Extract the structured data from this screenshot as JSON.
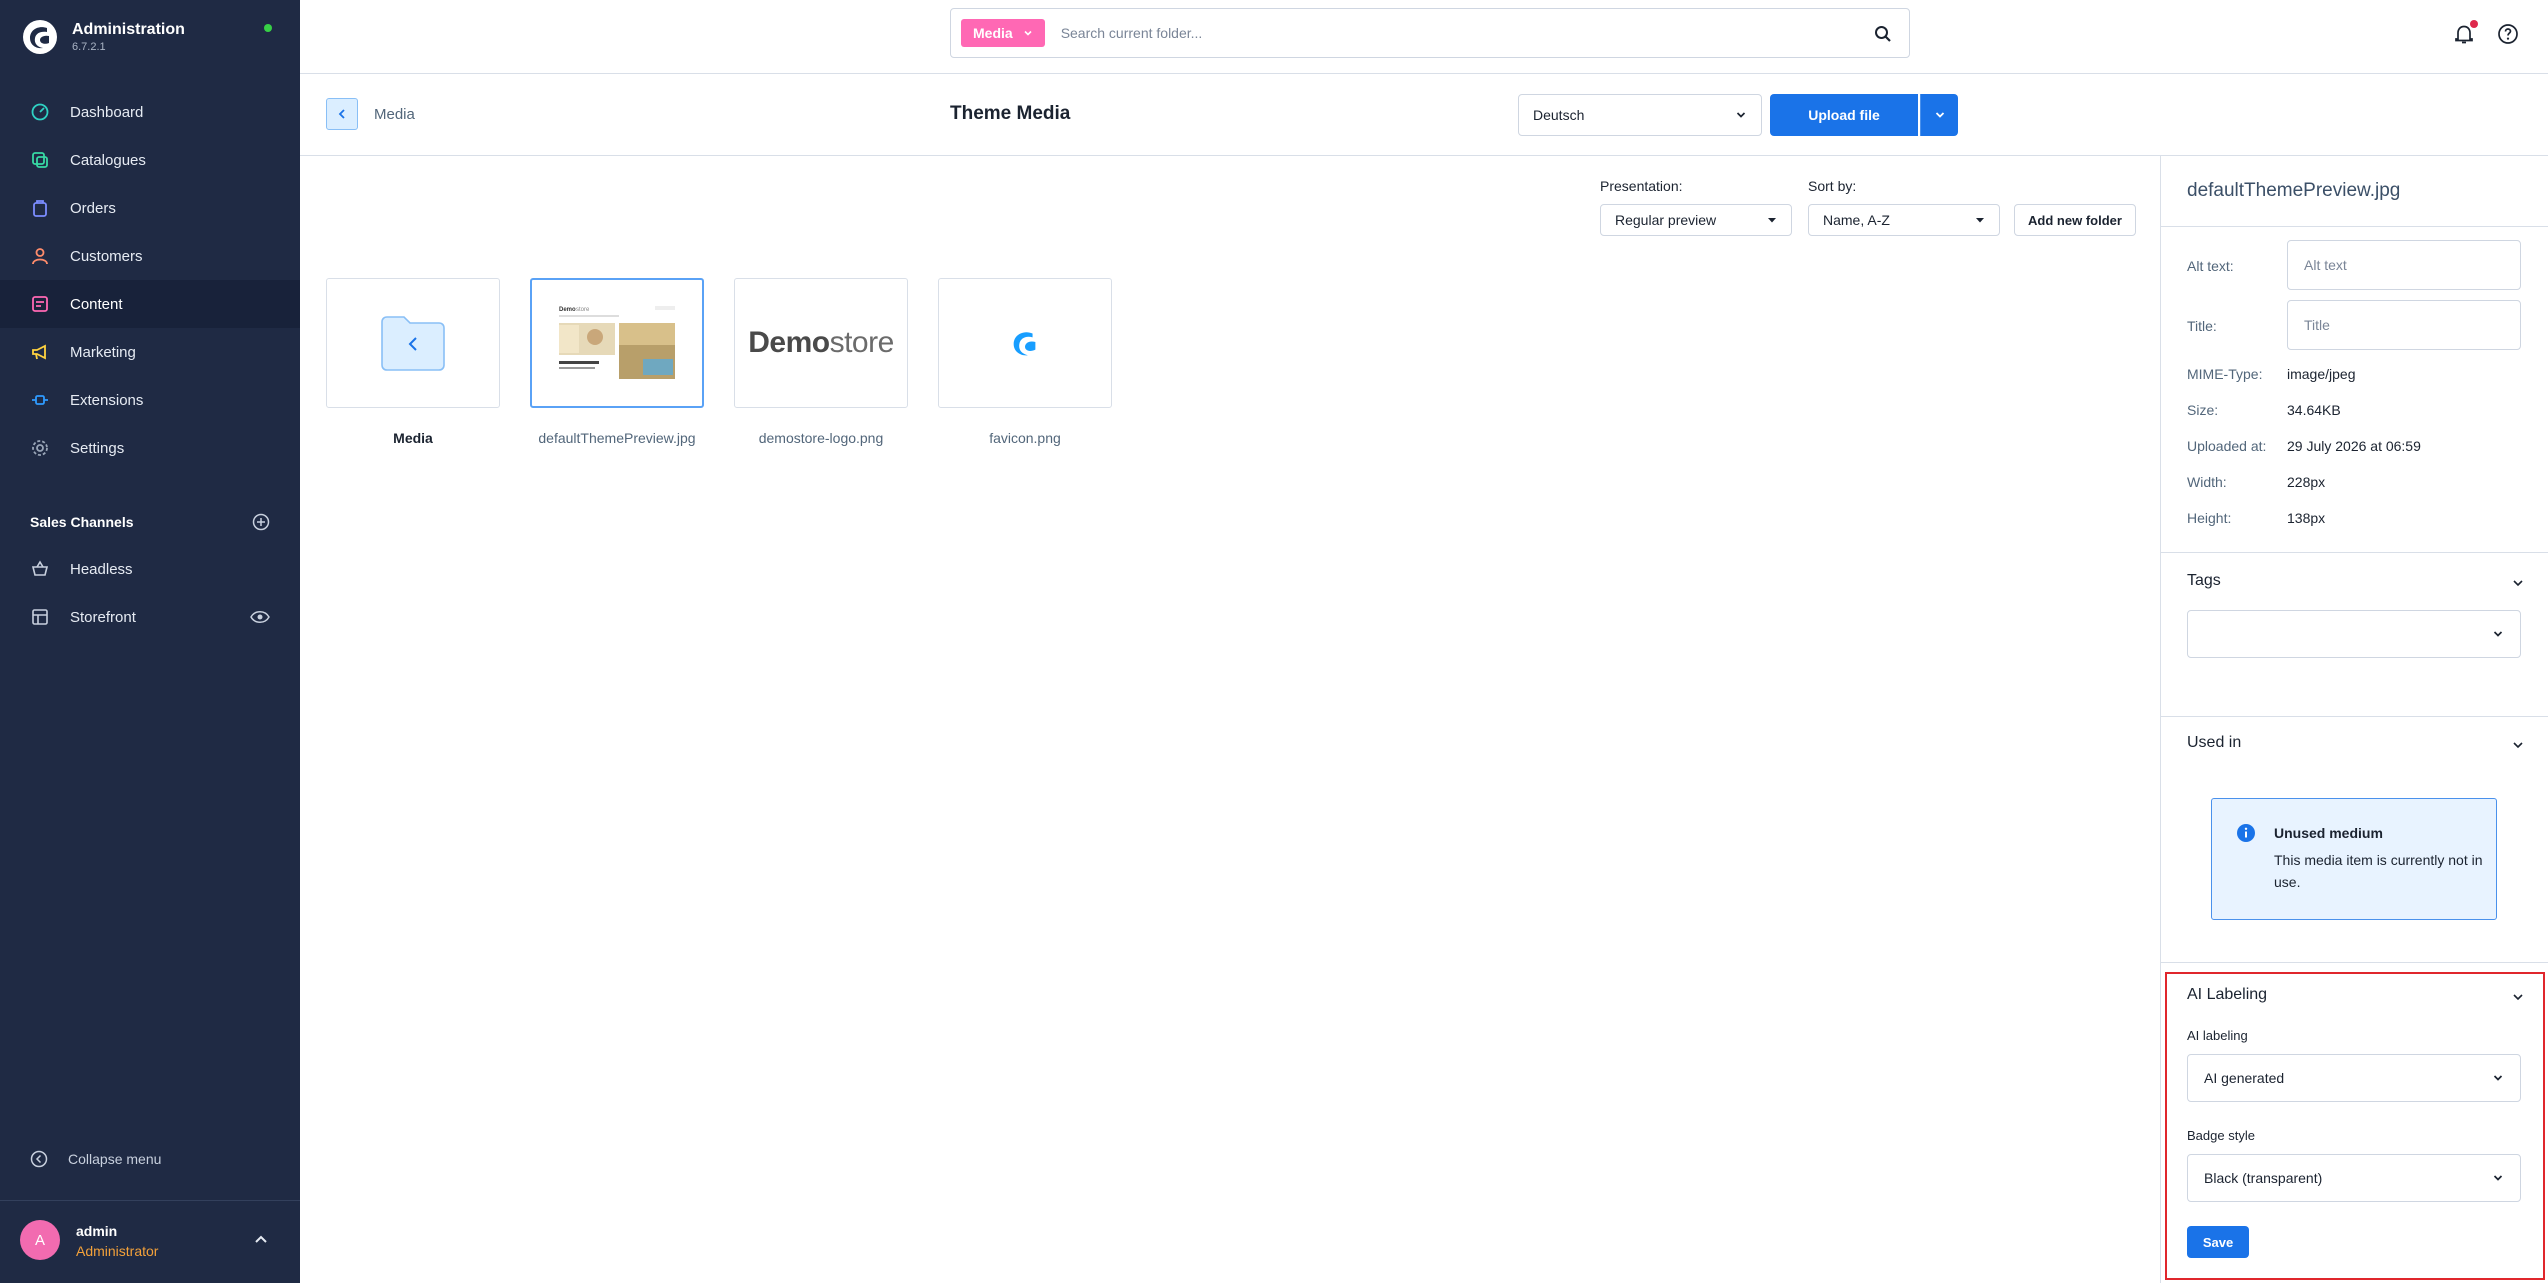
{
  "sidebar": {
    "brand_title": "Administration",
    "brand_version": "6.7.2.1",
    "nav": [
      {
        "label": "Dashboard",
        "icon": "dashboard-icon"
      },
      {
        "label": "Catalogues",
        "icon": "catalogue-icon"
      },
      {
        "label": "Orders",
        "icon": "orders-icon"
      },
      {
        "label": "Customers",
        "icon": "customers-icon"
      },
      {
        "label": "Content",
        "icon": "content-icon",
        "active": true
      },
      {
        "label": "Marketing",
        "icon": "megaphone-icon"
      },
      {
        "label": "Extensions",
        "icon": "plug-icon"
      },
      {
        "label": "Settings",
        "icon": "gear-icon"
      }
    ],
    "sales_channels_title": "Sales Channels",
    "sales_channels": [
      {
        "label": "Headless",
        "icon": "basket-icon"
      },
      {
        "label": "Storefront",
        "icon": "storefront-icon"
      }
    ],
    "collapse_label": "Collapse menu",
    "user": {
      "initial": "A",
      "name": "admin",
      "role": "Administrator"
    }
  },
  "topbar": {
    "search_type": "Media",
    "search_placeholder": "Search current folder..."
  },
  "header": {
    "breadcrumb": "Media",
    "title": "Theme Media",
    "language": "Deutsch",
    "upload_label": "Upload file"
  },
  "toolbar": {
    "presentation_label": "Presentation:",
    "presentation_value": "Regular preview",
    "sort_label": "Sort by:",
    "sort_value": "Name, A-Z",
    "add_folder_label": "Add new folder"
  },
  "media_items": [
    {
      "label": "Media",
      "kind": "folder-back"
    },
    {
      "label": "defaultThemePreview.jpg",
      "kind": "image",
      "selected": true
    },
    {
      "label": "demostore-logo.png",
      "kind": "logo"
    },
    {
      "label": "favicon.png",
      "kind": "favicon"
    }
  ],
  "preview": {
    "logo_strong": "Demo",
    "logo_light": "store"
  },
  "panel": {
    "file_name": "defaultThemePreview.jpg",
    "alt_label": "Alt text:",
    "alt_placeholder": "Alt text",
    "title_label": "Title:",
    "title_placeholder": "Title",
    "meta": [
      {
        "label": "MIME-Type:",
        "value": "image/jpeg"
      },
      {
        "label": "Size:",
        "value": "34.64KB"
      },
      {
        "label": "Uploaded at:",
        "value": "29 July 2026 at 06:59"
      },
      {
        "label": "Width:",
        "value": "228px"
      },
      {
        "label": "Height:",
        "value": "138px"
      }
    ],
    "tags_title": "Tags",
    "used_in_title": "Used in",
    "unused_title": "Unused medium",
    "unused_text": "This media item is currently not in use.",
    "ai_title": "AI Labeling",
    "ai_label": "AI labeling",
    "ai_value": "AI generated",
    "badge_label": "Badge style",
    "badge_value": "Black (transparent)",
    "save_label": "Save"
  },
  "colors": {
    "sidebar_bg": "#1f2a44",
    "primary": "#1a73e8",
    "search_badge": "#ff68b4",
    "highlight_border": "#e0262c"
  }
}
